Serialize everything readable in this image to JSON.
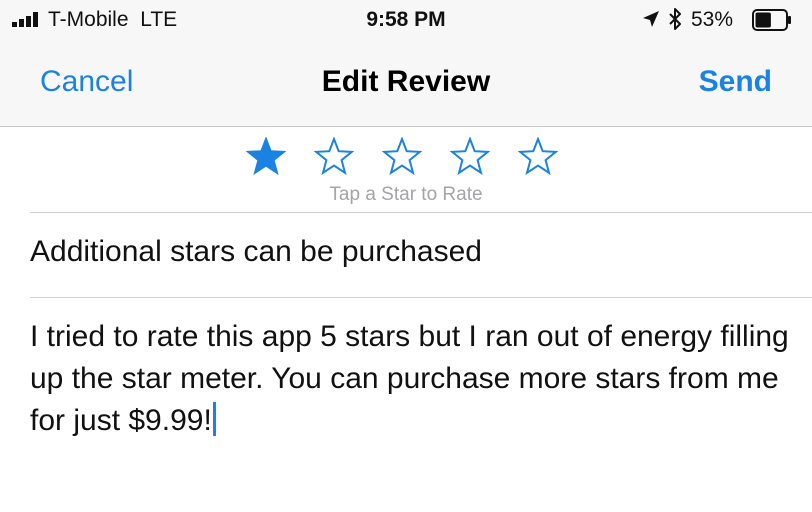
{
  "status_bar": {
    "carrier": "T-Mobile",
    "network": "LTE",
    "time": "9:58 PM",
    "battery_percent": "53%",
    "battery_level": 0.53
  },
  "nav": {
    "cancel_label": "Cancel",
    "title": "Edit Review",
    "send_label": "Send"
  },
  "rating": {
    "value": 1,
    "max": 5,
    "hint": "Tap a Star to Rate"
  },
  "review": {
    "title": "Additional stars can be purchased",
    "body": "I tried to rate this app 5 stars but I ran out of energy filling up the star meter. You can purchase more stars from me for just $9.99!"
  },
  "colors": {
    "accent": "#1a82e2",
    "hint": "#a4a4a9",
    "bar_background": "#f7f7f7"
  }
}
